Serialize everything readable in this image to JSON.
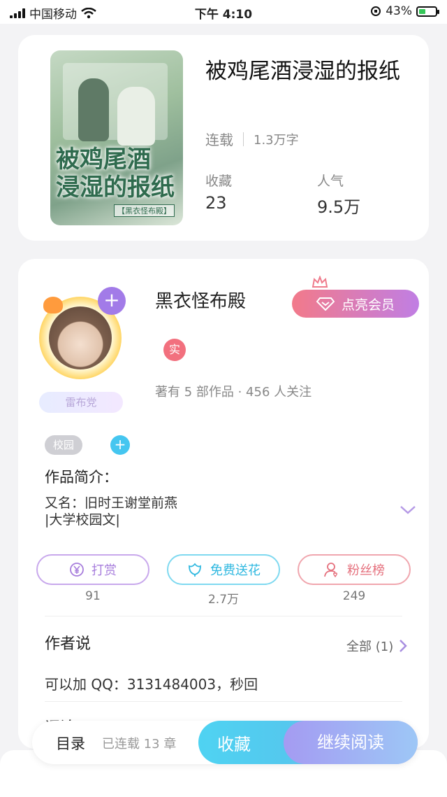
{
  "status_bar": {
    "carrier": "中国移动",
    "time": "下午 4:10",
    "battery": "43%",
    "battery_level": 0.43
  },
  "book": {
    "title": "被鸡尾酒浸湿的报纸",
    "status": "连载",
    "words": "1.3万字",
    "collect_label": "收藏",
    "collect_value": "23",
    "popularity_label": "人气",
    "popularity_value": "9.5万",
    "cover": {
      "title_line1": "被鸡尾酒",
      "title_line2": "浸湿的报纸",
      "author": "【黑衣怪布殿】"
    }
  },
  "author": {
    "name": "黑衣怪布殿",
    "vip_button": "点亮会员",
    "real_badge": "实",
    "party_badge": "雷布党",
    "works": "著有 5 部作品 · 456 人关注"
  },
  "tags": {
    "items": [
      "校园"
    ],
    "add": "+"
  },
  "intro": {
    "title": "作品简介：",
    "line1": "又名：旧时王谢堂前燕",
    "line2": "|大学校园文|"
  },
  "actions": [
    {
      "label": "打赏",
      "count": "91",
      "icon": "yen-icon",
      "color": "#b07de0"
    },
    {
      "label": "免费送花",
      "count": "2.7万",
      "icon": "flower-icon",
      "color": "#43c6e8"
    },
    {
      "label": "粉丝榜",
      "count": "249",
      "icon": "fan-icon",
      "color": "#ea7b86"
    }
  ],
  "author_say": {
    "title": "作者说",
    "all": "全部 (1)",
    "text": "可以加 QQ：3131484003，秒回",
    "next_section": "评论"
  },
  "bottom_bar": {
    "toc": "目录",
    "serial": "已连载 13 章",
    "collect": "收藏",
    "read": "继续阅读"
  }
}
